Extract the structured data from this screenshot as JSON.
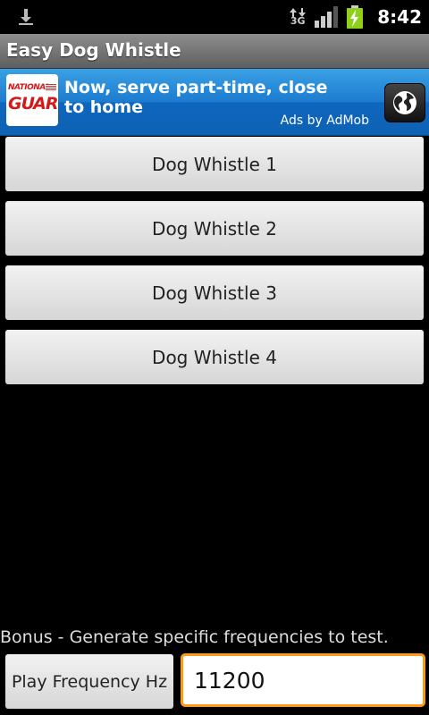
{
  "status_bar": {
    "download_icon": "download-icon",
    "network_label": "3G",
    "signal_icon": "signal-icon",
    "battery_icon": "battery-charging-icon",
    "time": "8:42"
  },
  "app": {
    "title": "Easy Dog Whistle"
  },
  "ad": {
    "logo_line1": "NATIONAL",
    "logo_line2": "GUARD",
    "headline": "Now, serve part-time, close to home",
    "attribution": "Ads by AdMob",
    "action_icon": "globe-icon"
  },
  "whistles": [
    {
      "label": "Dog Whistle 1"
    },
    {
      "label": "Dog Whistle 2"
    },
    {
      "label": "Dog Whistle 3"
    },
    {
      "label": "Dog Whistle 4"
    }
  ],
  "bonus": {
    "description": "Bonus - Generate specific frequencies to test.",
    "play_label": "Play Frequency Hz",
    "frequency_value": "11200"
  },
  "colors": {
    "ad_blue": "#1c7cd0",
    "focus_orange": "#ff9a17"
  }
}
